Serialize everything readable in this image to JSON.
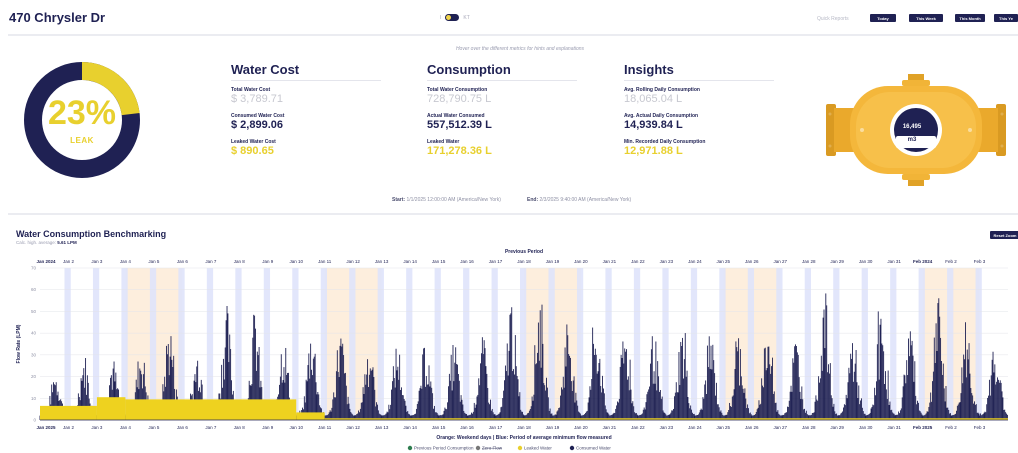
{
  "header": {
    "address": "470 Chrysler Dr",
    "quick_reports_label": "Quick Reports",
    "buttons": [
      "Today",
      "This Week",
      "This Month",
      "This Ye"
    ]
  },
  "hint": "Hover over the different metrics for hints and explanations",
  "leak": {
    "percent": "23%",
    "label": "LEAK",
    "fraction": 0.23
  },
  "water_cost": {
    "title": "Water Cost",
    "total_label": "Total Water Cost",
    "total_value": "$ 3,789.71",
    "consumed_label": "Consumed Water Cost",
    "consumed_value": "$ 2,899.06",
    "leaked_label": "Leaked Water Cost",
    "leaked_value": "$ 890.65"
  },
  "consumption": {
    "title": "Consumption",
    "total_label": "Total Water Consumption",
    "total_value": "728,790.75 L",
    "actual_label": "Actual Water Consumed",
    "actual_value": "557,512.39 L",
    "leaked_label": "Leaked Water",
    "leaked_value": "171,278.36 L"
  },
  "insights": {
    "title": "Insights",
    "rolling_label": "Avg. Rolling Daily Consumption",
    "rolling_value": "18,065.04 L",
    "actual_label": "Avg. Actual Daily Consumption",
    "actual_value": "14,939.84 L",
    "min_label": "Min. Recorded Daily Consumption",
    "min_value": "12,971.88 L"
  },
  "meter": {
    "value": "16,495",
    "unit": "m3"
  },
  "period": {
    "start_label": "Start:",
    "start_value": "1/1/2025 12:00:00 AM (America/New York)",
    "end_label": "End:",
    "end_value": "2/3/2025 9:40:00 AM (America/New York)"
  },
  "benchmark": {
    "title": "Water Consumption Benchmarking",
    "subtitle_prefix": "Calc. high. average:",
    "subtitle_value": "5.61 LPM",
    "reset_label": "Reset Zoom"
  },
  "colors": {
    "navy": "#1f2153",
    "gold": "#e8d02e",
    "weekend": "#fdeedd",
    "min_flow": "#dfe3fb",
    "leak_fill": "#eed21f"
  },
  "chart_data": {
    "type": "area",
    "top_title": "Previous Period",
    "bottom_title": "Orange: Weekend days | Blue: Period of average minimum flow measured",
    "ylabel": "Flow Rate (LPM)",
    "ylim": [
      0,
      70
    ],
    "yticks": [
      0,
      10,
      20,
      30,
      40,
      50,
      60,
      70
    ],
    "grid": true,
    "legend_position": "bottom",
    "top_ticks": [
      "Jan 2024",
      "Jan 2",
      "Jan 3",
      "Jan 4",
      "Jan 5",
      "Jan 6",
      "Jan 7",
      "Jan 8",
      "Jan 9",
      "Jan 10",
      "Jan 11",
      "Jan 12",
      "Jan 13",
      "Jan 14",
      "Jan 15",
      "Jan 16",
      "Jan 17",
      "Jan 18",
      "Jan 19",
      "Jan 20",
      "Jan 21",
      "Jan 22",
      "Jan 23",
      "Jan 24",
      "Jan 25",
      "Jan 26",
      "Jan 27",
      "Jan 28",
      "Jan 29",
      "Jan 30",
      "Jan 31",
      "Feb 2024",
      "Feb 2",
      "Feb 3"
    ],
    "bottom_ticks": [
      "Jan 2025",
      "Jan 2",
      "Jan 3",
      "Jan 4",
      "Jan 5",
      "Jan 6",
      "Jan 7",
      "Jan 8",
      "Jan 9",
      "Jan 10",
      "Jan 11",
      "Jan 12",
      "Jan 13",
      "Jan 14",
      "Jan 15",
      "Jan 16",
      "Jan 17",
      "Jan 18",
      "Jan 19",
      "Jan 20",
      "Jan 21",
      "Jan 22",
      "Jan 23",
      "Jan 24",
      "Jan 25",
      "Jan 26",
      "Jan 27",
      "Jan 28",
      "Jan 29",
      "Jan 30",
      "Jan 31",
      "Feb 2025",
      "Feb 2",
      "Feb 3"
    ],
    "weekend_day_ranges": [
      [
        3,
        5
      ],
      [
        10,
        12
      ],
      [
        17,
        19
      ],
      [
        24,
        26
      ],
      [
        31,
        33
      ]
    ],
    "min_flow_day_indices": [
      1,
      2,
      3,
      4,
      5,
      6,
      7,
      8,
      9,
      10,
      11,
      12,
      13,
      14,
      15,
      16,
      17,
      18,
      19,
      20,
      21,
      22,
      23,
      24,
      25,
      26,
      27,
      28,
      29,
      30,
      31,
      32,
      33
    ],
    "daily_peak_lpm": [
      22,
      30,
      28,
      34,
      46,
      32,
      52,
      50,
      40,
      44,
      42,
      36,
      35,
      36,
      36,
      37,
      58,
      60,
      49,
      48,
      42,
      40,
      42,
      41,
      40,
      45,
      38,
      60,
      40,
      50,
      48,
      55,
      45,
      40
    ],
    "leaked_water_steps": [
      {
        "from_day": 0,
        "to_day": 2,
        "value": 6.5
      },
      {
        "from_day": 2,
        "to_day": 3,
        "value": 10.5
      },
      {
        "from_day": 3,
        "to_day": 9,
        "value": 9.5
      },
      {
        "from_day": 9,
        "to_day": 10,
        "value": 3.5
      },
      {
        "from_day": 10,
        "to_day": 34,
        "value": 0.8
      }
    ],
    "series": [
      {
        "name": "Previous Period Consumption",
        "color": "#2e7d4f"
      },
      {
        "name": "Zero Flow",
        "color": "#777777"
      },
      {
        "name": "Leaked Water",
        "color": "#e8d02e"
      },
      {
        "name": "Consumed Water",
        "color": "#1f2153"
      }
    ]
  }
}
